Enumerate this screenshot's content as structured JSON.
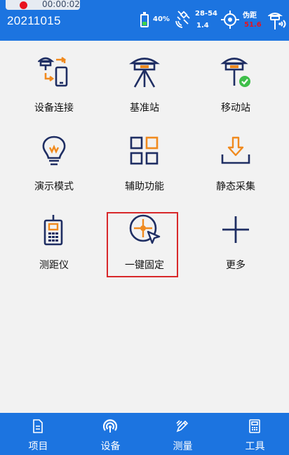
{
  "status_bar": {
    "recording_time": "00:00:02",
    "date": "20211015",
    "battery_percent": "40%",
    "battery_level": 0.4,
    "satellites": "28-54",
    "precision": "1.4",
    "pseudorange_label": "伪距",
    "pseudorange_value": "51.6"
  },
  "grid": [
    {
      "label": "设备连接",
      "icon": "device-connect-icon"
    },
    {
      "label": "基准站",
      "icon": "base-station-icon"
    },
    {
      "label": "移动站",
      "icon": "rover-icon"
    },
    {
      "label": "演示模式",
      "icon": "demo-bulb-icon"
    },
    {
      "label": "辅助功能",
      "icon": "grid-squares-icon"
    },
    {
      "label": "静态采集",
      "icon": "download-tray-icon"
    },
    {
      "label": "测距仪",
      "icon": "rangefinder-icon"
    },
    {
      "label": "一键固定",
      "icon": "crosshair-cursor-icon"
    },
    {
      "label": "更多",
      "icon": "plus-icon"
    }
  ],
  "bottom_nav": [
    {
      "label": "项目",
      "icon": "document-icon"
    },
    {
      "label": "设备",
      "icon": "device-signal-icon"
    },
    {
      "label": "测量",
      "icon": "survey-pen-icon"
    },
    {
      "label": "工具",
      "icon": "calculator-icon"
    }
  ],
  "colors": {
    "primary": "#1c74e0",
    "icon_dark": "#1f2e63",
    "icon_accent": "#f08a1e",
    "highlight": "#d8282a",
    "check_green": "#3fbf4a"
  }
}
